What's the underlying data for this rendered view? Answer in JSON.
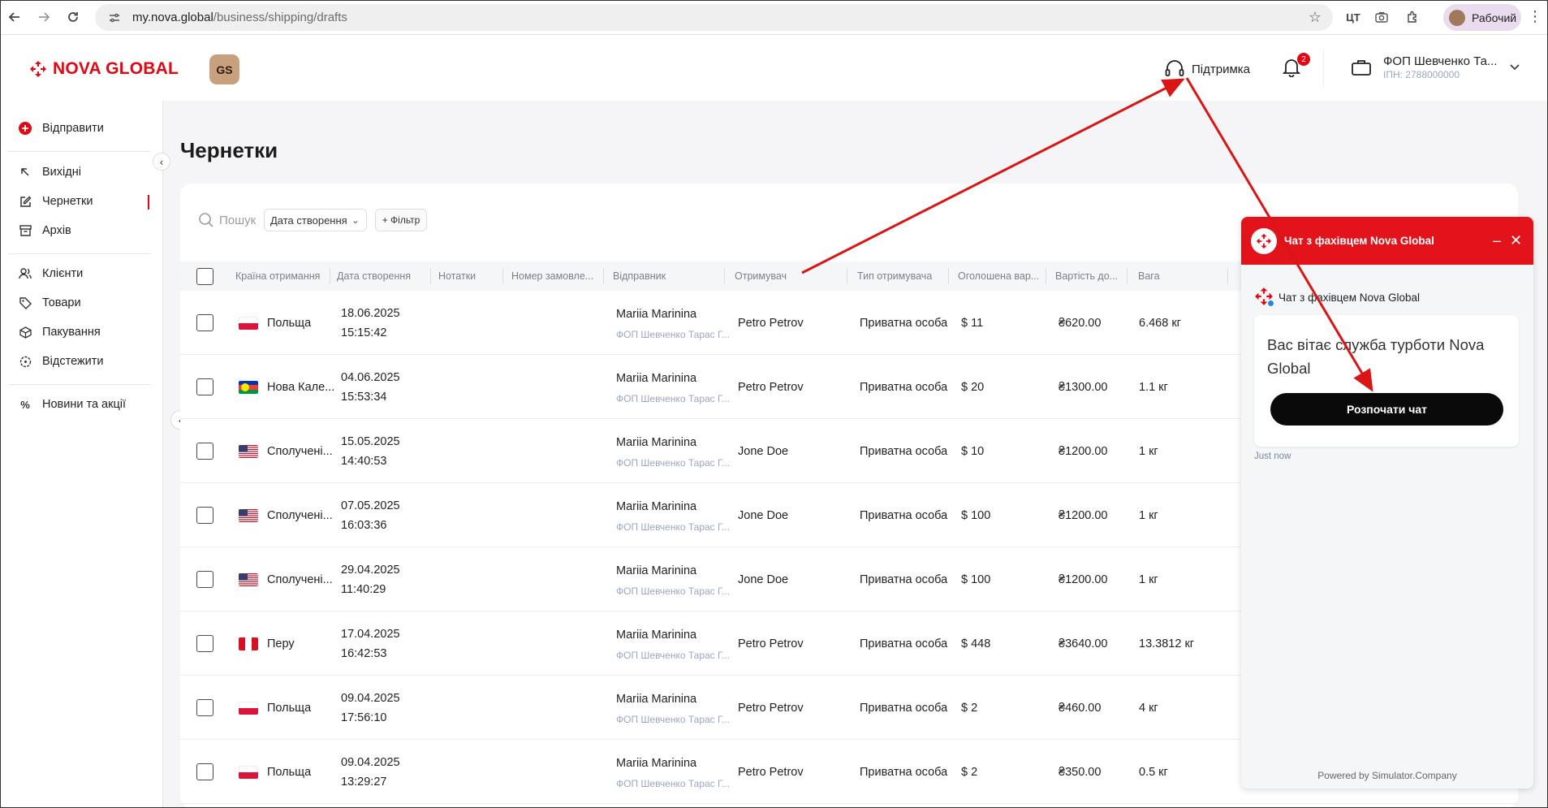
{
  "browser": {
    "url_host": "my.nova.global",
    "url_path": "/business/shipping/drafts",
    "profile_label": "Рабочий"
  },
  "header": {
    "logo_text": "NOVA GLOBAL",
    "badge_text": "GS",
    "support_label": "Підтримка",
    "notifications_count": "2",
    "account_name": "ФОП Шевченко Та...",
    "account_inn": "ІПН: 2788000000"
  },
  "sidebar": {
    "send_label": "Відправити",
    "items": [
      {
        "label": "Вихідні"
      },
      {
        "label": "Чернетки"
      },
      {
        "label": "Архів"
      },
      {
        "label": "Клієнти"
      },
      {
        "label": "Товари"
      },
      {
        "label": "Пакування"
      },
      {
        "label": "Відстежити"
      },
      {
        "label": "Новини та акції"
      }
    ]
  },
  "main": {
    "title": "Чернетки",
    "search_placeholder": "Пошук",
    "date_filter": "Дата створення",
    "add_filter": "+ Фільтр",
    "columns": [
      "Країна отримання",
      "Дата створення",
      "Нотатки",
      "Номер замовле...",
      "Відправник",
      "Отримувач",
      "Тип отримувача",
      "Оголошена вар...",
      "Вартість до...",
      "Вага"
    ],
    "rows": [
      {
        "country": "Польща",
        "flag": "pl",
        "date": "18.06.2025",
        "time": "15:15:42",
        "sender": "Mariia Marinina",
        "sender_sub": "ФОП Шевченко Тарас Г...",
        "recipient": "Petro Petrov",
        "recipient_type": "Приватна особа",
        "declared": "$ 11",
        "cost": "₴620.00",
        "weight": "6.468 кг"
      },
      {
        "country": "Нова Кале...",
        "flag": "nc",
        "date": "04.06.2025",
        "time": "15:53:34",
        "sender": "Mariia Marinina",
        "sender_sub": "ФОП Шевченко Тарас Г...",
        "recipient": "Petro Petrov",
        "recipient_type": "Приватна особа",
        "declared": "$ 20",
        "cost": "₴1300.00",
        "weight": "1.1 кг"
      },
      {
        "country": "Сполучені...",
        "flag": "us",
        "date": "15.05.2025",
        "time": "14:40:53",
        "sender": "Mariia Marinina",
        "sender_sub": "ФОП Шевченко Тарас Г...",
        "recipient": "Jone Doe",
        "recipient_type": "Приватна особа",
        "declared": "$ 10",
        "cost": "₴1200.00",
        "weight": "1 кг"
      },
      {
        "country": "Сполучені...",
        "flag": "us",
        "date": "07.05.2025",
        "time": "16:03:36",
        "sender": "Mariia Marinina",
        "sender_sub": "ФОП Шевченко Тарас Г...",
        "recipient": "Jone Doe",
        "recipient_type": "Приватна особа",
        "declared": "$ 100",
        "cost": "₴1200.00",
        "weight": "1 кг"
      },
      {
        "country": "Сполучені...",
        "flag": "us",
        "date": "29.04.2025",
        "time": "11:40:29",
        "sender": "Mariia Marinina",
        "sender_sub": "ФОП Шевченко Тарас Г...",
        "recipient": "Jone Doe",
        "recipient_type": "Приватна особа",
        "declared": "$ 100",
        "cost": "₴1200.00",
        "weight": "1 кг"
      },
      {
        "country": "Перу",
        "flag": "pe",
        "date": "17.04.2025",
        "time": "16:42:53",
        "sender": "Mariia Marinina",
        "sender_sub": "ФОП Шевченко Тарас Г...",
        "recipient": "Petro Petrov",
        "recipient_type": "Приватна особа",
        "declared": "$ 448",
        "cost": "₴3640.00",
        "weight": "13.3812 кг"
      },
      {
        "country": "Польща",
        "flag": "pl",
        "date": "09.04.2025",
        "time": "17:56:10",
        "sender": "Mariia Marinina",
        "sender_sub": "ФОП Шевченко Тарас Г...",
        "recipient": "Petro Petrov",
        "recipient_type": "Приватна особа",
        "declared": "$ 2",
        "cost": "₴460.00",
        "weight": "4 кг"
      },
      {
        "country": "Польща",
        "flag": "pl",
        "date": "09.04.2025",
        "time": "13:29:27",
        "sender": "Mariia Marinina",
        "sender_sub": "ФОП Шевченко Тарас Г...",
        "recipient": "Petro Petrov",
        "recipient_type": "Приватна особа",
        "declared": "$ 2",
        "cost": "₴350.00",
        "weight": "0.5 кг"
      }
    ]
  },
  "chat": {
    "title": "Чат з фахівцем Nova Global",
    "sender": "Чат з фахівцем Nova Global",
    "message": "Вас вітає служба турботи Nova Global",
    "start_button": "Розпочати чат",
    "time": "Just now",
    "powered": "Powered by Simulator.Company"
  },
  "colors": {
    "brand_red": "#e30613",
    "chat_header": "#e3131c",
    "annotation_arrow": "#d91515"
  }
}
